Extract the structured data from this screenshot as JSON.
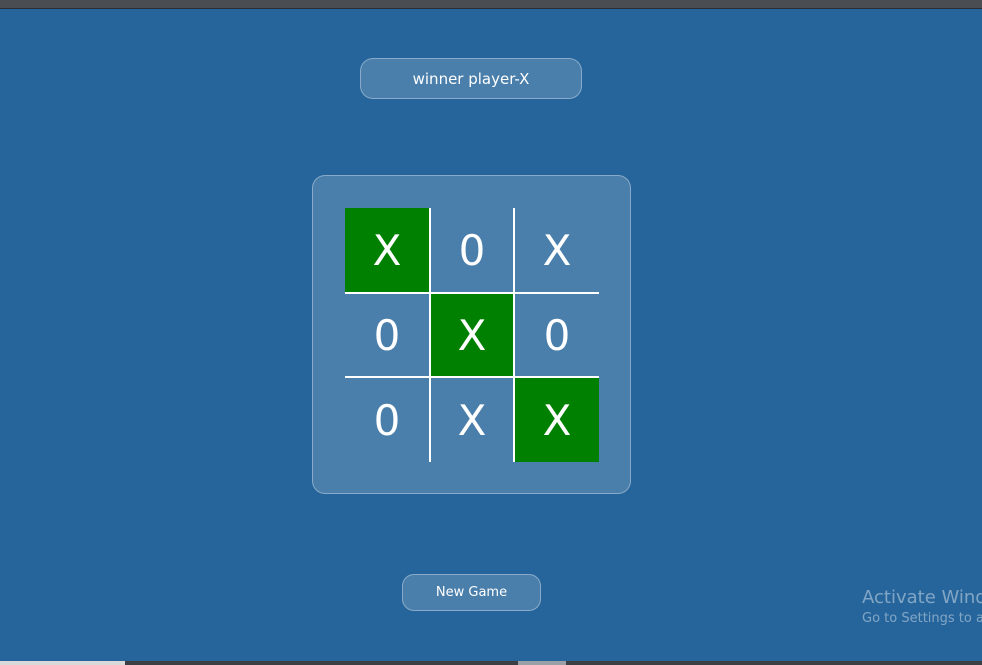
{
  "status": {
    "message": "winner player-X"
  },
  "board": {
    "cells": [
      {
        "mark": "X",
        "winning": true
      },
      {
        "mark": "0",
        "winning": false
      },
      {
        "mark": "X",
        "winning": false
      },
      {
        "mark": "0",
        "winning": false
      },
      {
        "mark": "X",
        "winning": true
      },
      {
        "mark": "0",
        "winning": false
      },
      {
        "mark": "0",
        "winning": false
      },
      {
        "mark": "X",
        "winning": false
      },
      {
        "mark": "X",
        "winning": true
      }
    ]
  },
  "controls": {
    "new_game_label": "New Game"
  },
  "watermark": {
    "title": "Activate Windows",
    "subtitle": "Go to Settings to activate Windows."
  },
  "colors": {
    "background": "#26659b",
    "winning_cell": "#008000",
    "text": "#ffffff"
  }
}
